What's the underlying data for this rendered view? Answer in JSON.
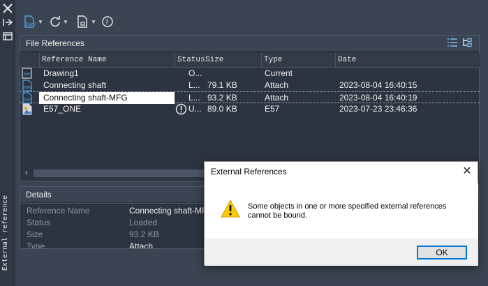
{
  "palette": {
    "title": "External reference"
  },
  "toolbar": {
    "attach_icon_label": "DWG",
    "help_icon_label": "?"
  },
  "file_references": {
    "header": "File References",
    "columns": [
      "Reference Name",
      "Status",
      "Size",
      "Type",
      "Date"
    ],
    "rows": [
      {
        "name": "Drawing1",
        "status": "O...",
        "size": "",
        "type": "Current",
        "date": ""
      },
      {
        "name": "Connecting shaft",
        "status": "L...",
        "size": "79.1 KB",
        "type": "Attach",
        "date": "2023-08-04 16:40:15"
      },
      {
        "name": "Connecting shaft-MFG",
        "status": "L...",
        "size": "93.2 KB",
        "type": "Attach",
        "date": "2023-08-04 16:40:19"
      },
      {
        "name": "E57_ONE",
        "status": "U...",
        "size": "89.0 KB",
        "type": "E57",
        "date": "2023-07-23 23:46:36"
      }
    ],
    "scroll_left": "‹"
  },
  "details": {
    "header": "Details",
    "fields": [
      {
        "label": "Reference Name",
        "value": "Connecting shaft-MFG"
      },
      {
        "label": "Status",
        "value": "Loaded"
      },
      {
        "label": "Size",
        "value": "93.2 KB"
      },
      {
        "label": "Type",
        "value": "Attach"
      }
    ]
  },
  "dialog": {
    "title": "External References",
    "message": "Some objects in one or more specified external references cannot be bound.",
    "ok_label": "OK",
    "close_glyph": "✕"
  }
}
